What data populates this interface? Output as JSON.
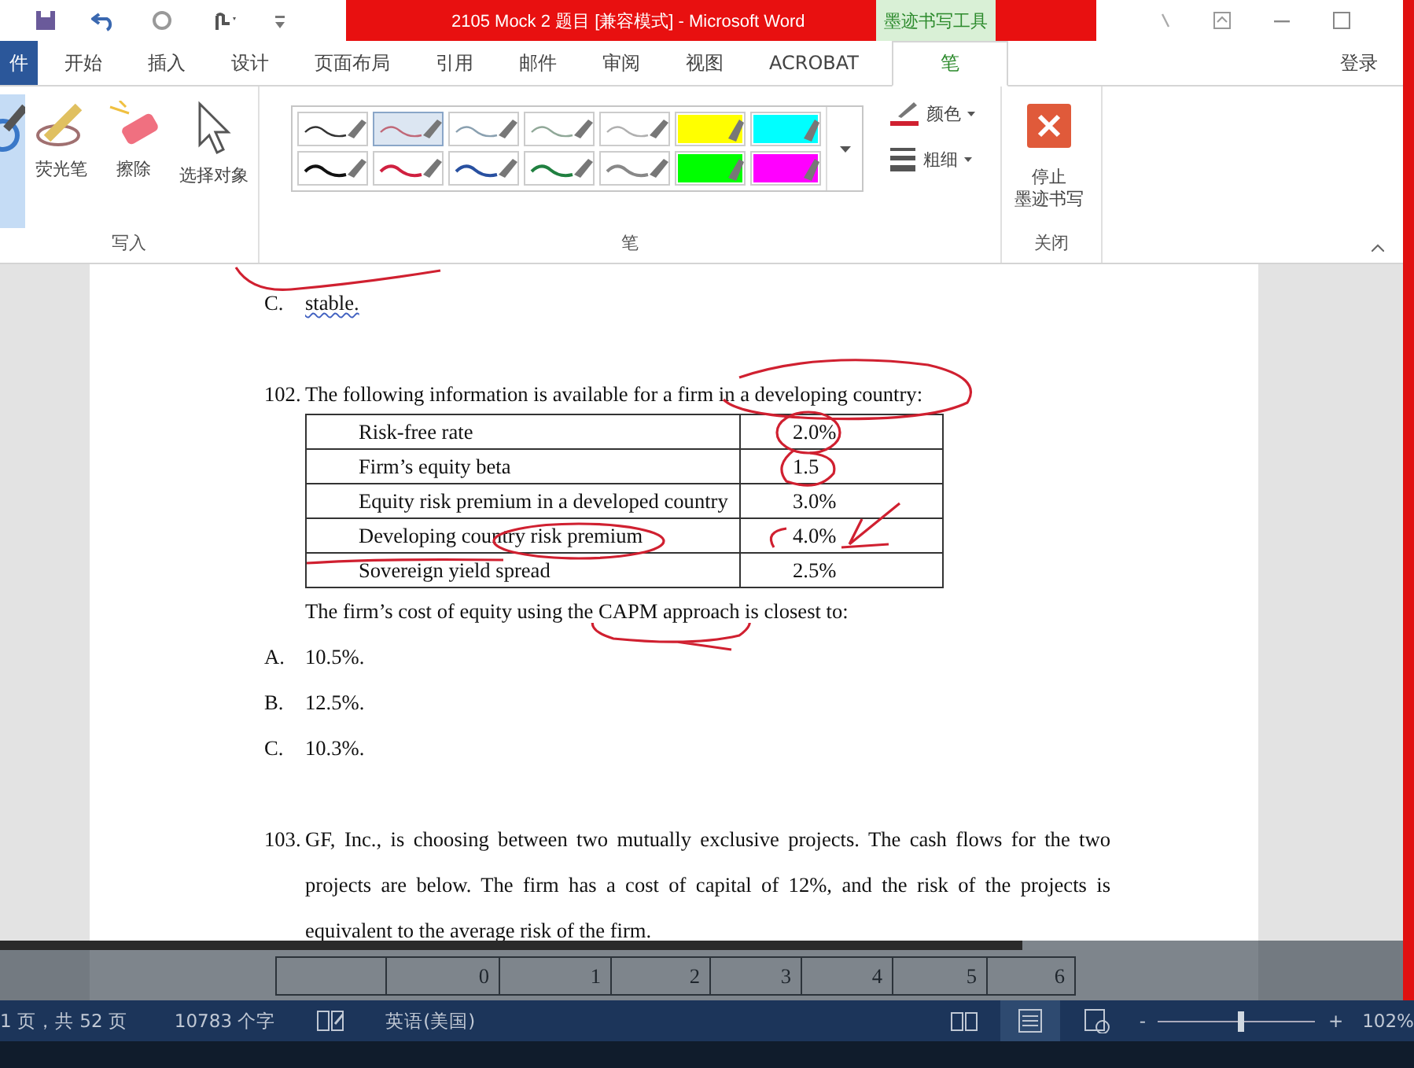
{
  "title_bar": {
    "title": "2105 Mock 2 题目 [兼容模式] -  Microsoft Word",
    "context_tab": "墨迹书写工具"
  },
  "tabs": [
    {
      "label": "件",
      "kind": "file",
      "selected": false
    },
    {
      "label": "开始",
      "kind": "tab",
      "selected": false
    },
    {
      "label": "插入",
      "kind": "tab",
      "selected": false
    },
    {
      "label": "设计",
      "kind": "tab",
      "selected": false
    },
    {
      "label": "页面布局",
      "kind": "tab",
      "selected": false
    },
    {
      "label": "引用",
      "kind": "tab",
      "selected": false
    },
    {
      "label": "邮件",
      "kind": "tab",
      "selected": false
    },
    {
      "label": "审阅",
      "kind": "tab",
      "selected": false
    },
    {
      "label": "视图",
      "kind": "tab",
      "selected": false
    },
    {
      "label": "ACROBAT",
      "kind": "tab",
      "selected": false
    },
    {
      "label": "笔",
      "kind": "tab",
      "selected": true
    }
  ],
  "account": "登录",
  "ribbon": {
    "write_group": "写入",
    "write_tools": [
      {
        "kind": "pen",
        "selected": true
      },
      {
        "kind": "highlighter",
        "label": "荧光笔",
        "selected": false
      },
      {
        "kind": "eraser",
        "label": "擦除",
        "selected": false
      },
      {
        "kind": "select",
        "label": "选择对象",
        "selected": false
      }
    ],
    "pens_group": "笔",
    "pens": [
      {
        "kind": "pen",
        "color": "#333333",
        "selected": false
      },
      {
        "kind": "pen",
        "color": "#c06878",
        "selected": true
      },
      {
        "kind": "pen",
        "color": "#8aa0b0",
        "selected": false
      },
      {
        "kind": "pen",
        "color": "#90a898",
        "selected": false
      },
      {
        "kind": "pen",
        "color": "#b0b0b0",
        "selected": false
      },
      {
        "kind": "highlighter",
        "color": "#ffff00",
        "selected": false
      },
      {
        "kind": "highlighter",
        "color": "#00ffff",
        "selected": false
      },
      {
        "kind": "pen",
        "color": "#111111",
        "selected": false
      },
      {
        "kind": "pen",
        "color": "#d02040",
        "selected": false
      },
      {
        "kind": "pen",
        "color": "#2850a0",
        "selected": false
      },
      {
        "kind": "pen",
        "color": "#208040",
        "selected": false
      },
      {
        "kind": "pen",
        "color": "#888888",
        "selected": false
      },
      {
        "kind": "highlighter",
        "color": "#00ff00",
        "selected": false
      },
      {
        "kind": "highlighter",
        "color": "#ff00ff",
        "selected": false
      }
    ],
    "color_button": "颜色",
    "thickness_button": "粗细",
    "stop_button": [
      "停止",
      "墨迹书写"
    ],
    "close_group": "关闭"
  },
  "document": [
    {
      "kind": "option",
      "marker": "C.",
      "text": "stable.",
      "misspelled": true
    },
    {
      "kind": "blank"
    },
    {
      "kind": "question",
      "number": "102.",
      "text": "The following information is available for a firm in a developing country:"
    },
    {
      "kind": "data_table",
      "rows": [
        {
          "label": "Risk-free rate",
          "value": "2.0%"
        },
        {
          "label": "Firm’s equity beta",
          "value": "1.5"
        },
        {
          "label": "Equity risk premium in a developed country",
          "value": "3.0%"
        },
        {
          "label": "Developing country risk premium",
          "value": "4.0%"
        },
        {
          "label": "Sovereign yield spread",
          "value": "2.5%"
        }
      ]
    },
    {
      "kind": "text",
      "text": "The firm’s cost of equity using the CAPM approach is closest to:"
    },
    {
      "kind": "option",
      "marker": "A.",
      "text": "10.5%.",
      "misspelled": false
    },
    {
      "kind": "option",
      "marker": "B.",
      "text": "12.5%.",
      "misspelled": false
    },
    {
      "kind": "option",
      "marker": "C.",
      "text": "10.3%.",
      "misspelled": false
    },
    {
      "kind": "blank"
    },
    {
      "kind": "question",
      "number": "103.",
      "text": "GF, Inc., is choosing between two mutually exclusive projects. The cash flows for the two projects are below. The firm has a cost of capital of 12%, and the risk of the projects is equivalent to the average risk of the firm."
    },
    {
      "kind": "cash_flow_table",
      "header": [
        "0",
        "1",
        "2",
        "3",
        "4",
        "5",
        "6"
      ]
    }
  ],
  "status_bar": {
    "page": "1 页，共 52 页",
    "words": "10783 个字",
    "language": "英语(美国)",
    "views": [
      {
        "kind": "read",
        "selected": false
      },
      {
        "kind": "print",
        "selected": true
      },
      {
        "kind": "web",
        "selected": false
      }
    ],
    "zoom_out": "-",
    "zoom_slider": {
      "level": 0.53
    },
    "zoom_in": "+",
    "zoom": "102%"
  }
}
